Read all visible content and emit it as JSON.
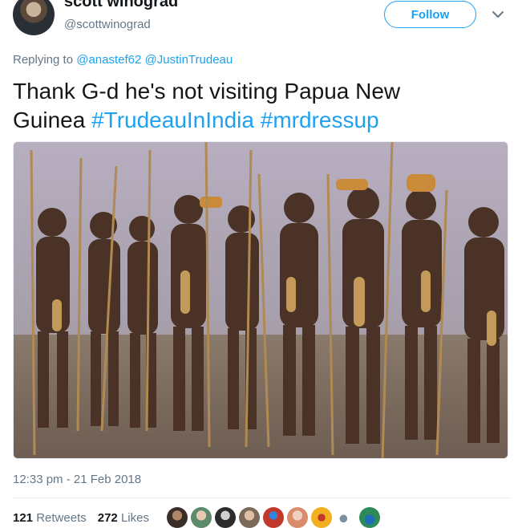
{
  "author": {
    "display_name": "scott winograd",
    "handle": "@scottwinograd"
  },
  "follow_button": {
    "label": "Follow"
  },
  "reply_context": {
    "prefix": "Replying to",
    "mentions": [
      "@anastef62",
      "@JustinTrudeau"
    ]
  },
  "tweet": {
    "text_line1": "Thank G-d he's not visiting Papua New",
    "text_line2_prefix": "Guinea",
    "hashtags": [
      "#TrudeauInIndia",
      "#mrdressup"
    ]
  },
  "meta": {
    "timestamp": "12:33 pm - 21 Feb 2018"
  },
  "stats": {
    "retweets_count": "121",
    "retweets_label": "Retweets",
    "likes_count": "272",
    "likes_label": "Likes"
  },
  "icons": {
    "more": "chevron-down-icon"
  },
  "colors": {
    "accent": "#1da1f2",
    "secondary_text": "#657786",
    "primary_text": "#14171a"
  },
  "liker_avatars": [
    {
      "color": "#3a2e28"
    },
    {
      "color": "#5c8a6a"
    },
    {
      "color": "#2c2c2c"
    },
    {
      "color": "#7a6a5a"
    },
    {
      "color": "#c0392b"
    },
    {
      "color": "#d98c6a"
    },
    {
      "color": "#f2b01e"
    },
    {
      "color": "#ffffff"
    },
    {
      "color": "#2e8b57"
    }
  ]
}
